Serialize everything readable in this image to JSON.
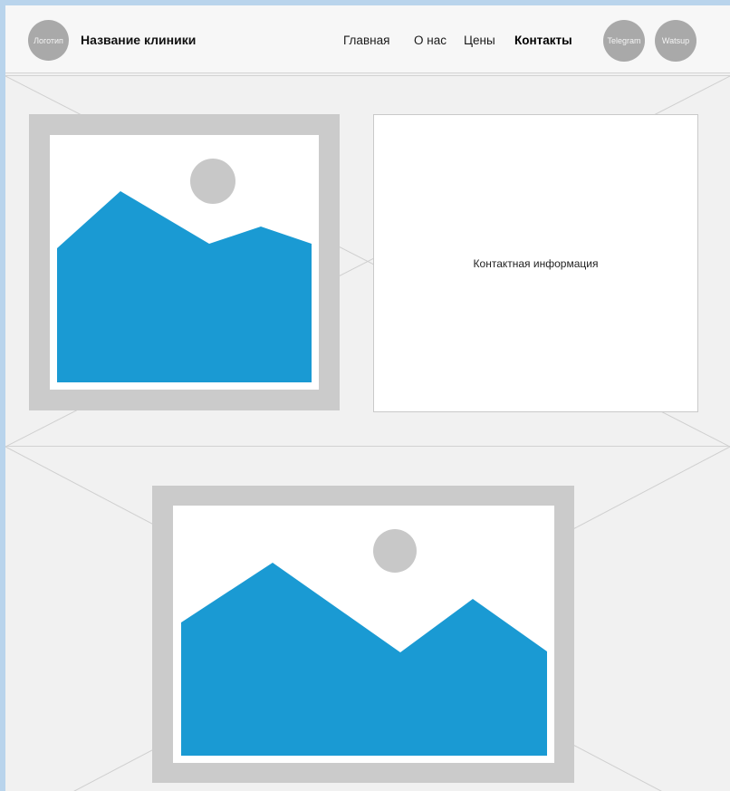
{
  "header": {
    "logo_label": "Логотип",
    "clinic_name": "Название клиники",
    "nav": [
      {
        "label": "Главная",
        "active": false
      },
      {
        "label": "О нас",
        "active": false
      },
      {
        "label": "Цены",
        "active": false
      },
      {
        "label": "Контакты",
        "active": true
      }
    ],
    "social": [
      {
        "label": "Telegram"
      },
      {
        "label": "Watsup"
      }
    ]
  },
  "contacts_section": {
    "contact_info": "Контактная информация",
    "image_icon": "image-placeholder-icon"
  },
  "lower_section": {
    "image_icon": "image-placeholder-icon"
  },
  "colors": {
    "background": "#f1f1f1",
    "placeholder_frame": "#cbcbcb",
    "mountain": "#1a9ad3",
    "sun": "#c8c8c8",
    "circle": "#a9a9a9",
    "outer": "#b9d4ec"
  }
}
